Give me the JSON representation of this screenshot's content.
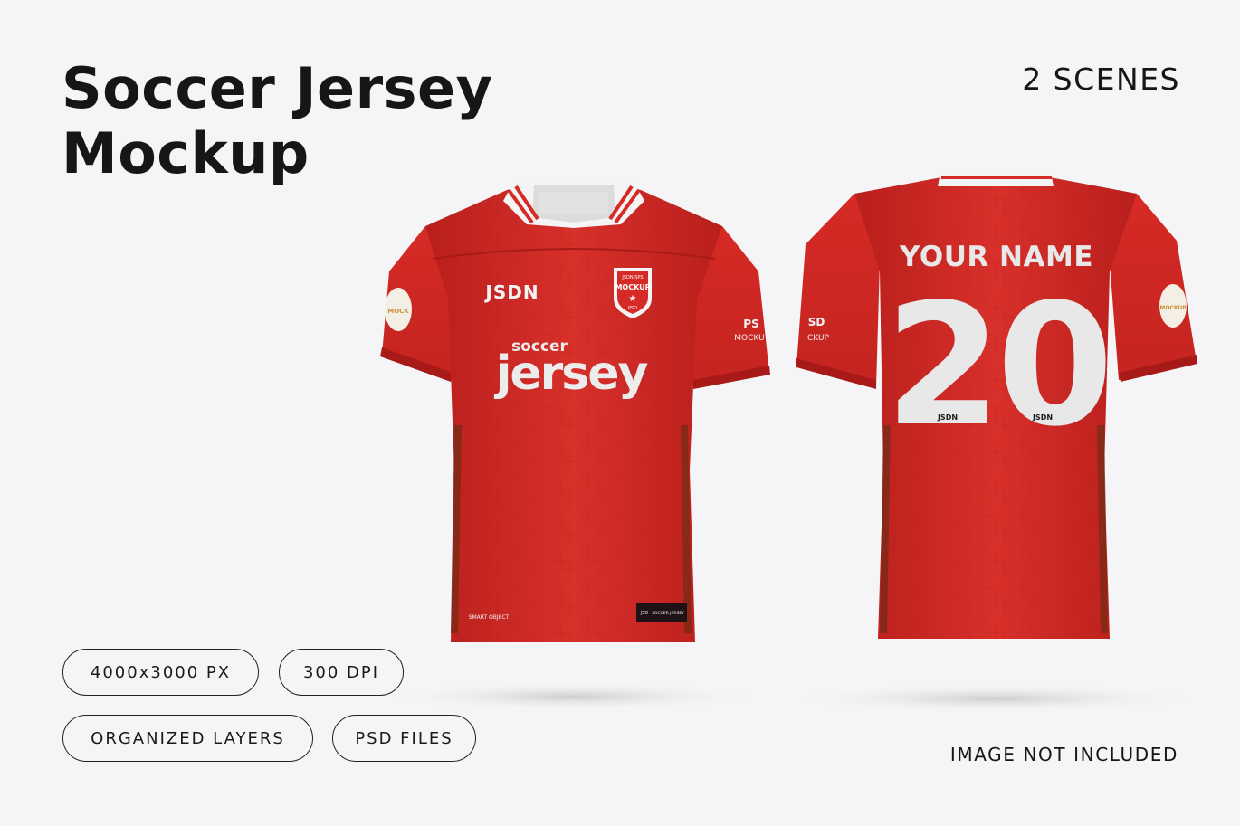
{
  "header": {
    "title_line1": "Soccer Jersey",
    "title_line2": "Mockup",
    "scenes": "2 SCENES"
  },
  "specs": [
    {
      "label": "4000x3000 PX"
    },
    {
      "label": "300 DPI"
    },
    {
      "label": "ORGANIZED LAYERS"
    },
    {
      "label": "PSD FILES"
    }
  ],
  "disclaimer": "IMAGE NOT INCLUDED",
  "front_jersey": {
    "brand_logo": "JSDN",
    "crest_top": "JSDN SPS",
    "crest_main": "MOCKUP",
    "crest_bottom": "PSD",
    "print_small": "soccer",
    "print_big": "jersey",
    "sleeve_text_1": "PS",
    "sleeve_text_2": "MOCKU",
    "hem_text": "SMART OBJECT",
    "tag_text": "SOCCER JERSEY"
  },
  "back_jersey": {
    "name": "YOUR NAME",
    "number": "20",
    "number_logo": "JSDN",
    "sleeve_text_1": "SD",
    "sleeve_text_2": "CKUP",
    "patch_text": "MOCKUP"
  },
  "colors": {
    "jersey_red": "#d62a26",
    "jersey_dark": "#b51f1c",
    "trim_white": "#f4f4f4",
    "print_white": "#e8e8e8",
    "text_dark": "#161616"
  }
}
